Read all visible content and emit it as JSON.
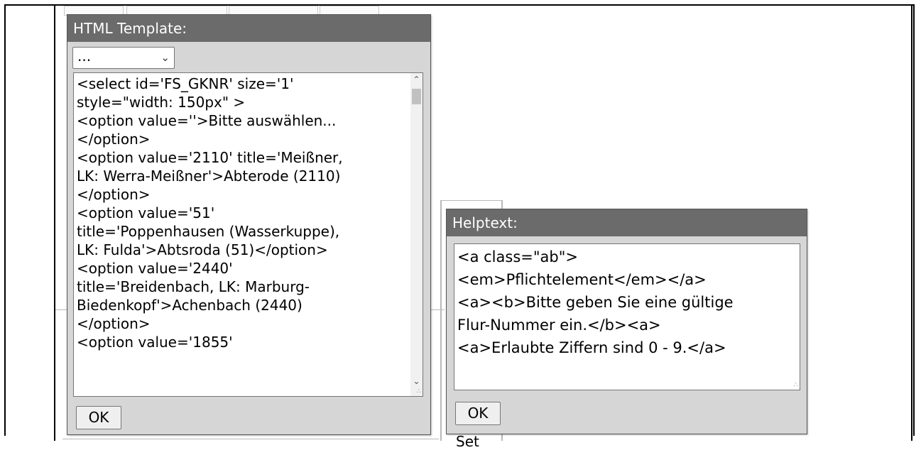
{
  "template_dialog": {
    "title": "HTML Template:",
    "select_value": "...",
    "code_lines": [
      "<select id='FS_GKNR' size='1'",
      "style=\"width: 150px\" >",
      "<option value=''>Bitte auswählen...",
      "</option>",
      "<option value='2110' title='Meißner,",
      "LK: Werra-Meißner'>Abterode (2110)",
      "</option>",
      "<option value='51'",
      "title='Poppenhausen (Wasserkuppe),",
      "LK: Fulda'>Abtsroda (51)</option>",
      "<option value='2440'",
      "title='Breidenbach, LK: Marburg-",
      "Biedenkopf'>Achenbach (2440)",
      "</option>",
      "<option value='1855'"
    ],
    "ok_label": "OK"
  },
  "help_dialog": {
    "title": "Helptext:",
    "code_lines": [
      "<a class=\"ab\">",
      "<em>Pflichtelement</em></a>",
      "<a><b>Bitte geben Sie eine gültige",
      "Flur-Nummer ein.</b><a>",
      "<a>Erlaubte Ziffern sind 0 - 9.</a>"
    ],
    "ok_label": "OK"
  },
  "background": {
    "partial_button_text": "Set"
  }
}
